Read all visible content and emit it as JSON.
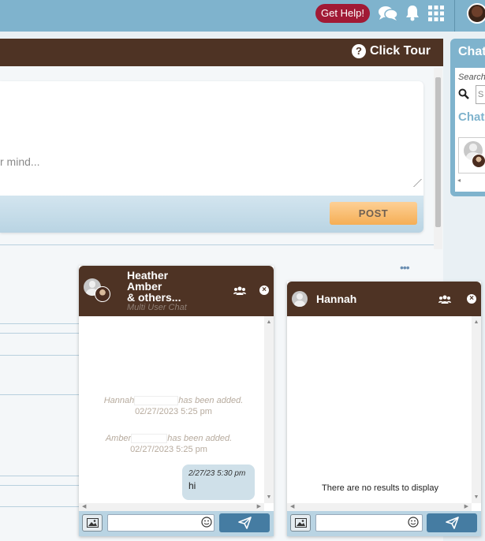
{
  "topbar": {
    "get_help_label": "Get Help!",
    "icons": [
      "chat-bubbles-icon",
      "bell-icon",
      "grid-icon"
    ],
    "brand_color": "#7fb3cd",
    "help_color": "#a11a35"
  },
  "main": {
    "header_color": "#4e3324",
    "click_tour_label": "Click Tour",
    "post_placeholder": "r mind...",
    "post_button": "POST",
    "more_icon": "•••"
  },
  "chat_panel": {
    "title": "Chat",
    "search_label": "Search",
    "search_value": "S",
    "section_title": "Chat"
  },
  "chat_group": {
    "names": [
      "Heather",
      "Amber",
      "& others..."
    ],
    "subtitle": "Multi User Chat",
    "messages": [
      {
        "name": "Hannah",
        "text": "has been added.",
        "time": "02/27/2023 5:25 pm"
      },
      {
        "name": "Amber",
        "text": "has been added.",
        "time": "02/27/2023 5:25 pm"
      }
    ],
    "bubble": {
      "time": "2/27/23 5:30 pm",
      "text": "hi"
    },
    "input_value": ""
  },
  "chat_single": {
    "name": "Hannah",
    "empty_text": "There are no results to display",
    "input_value": ""
  }
}
